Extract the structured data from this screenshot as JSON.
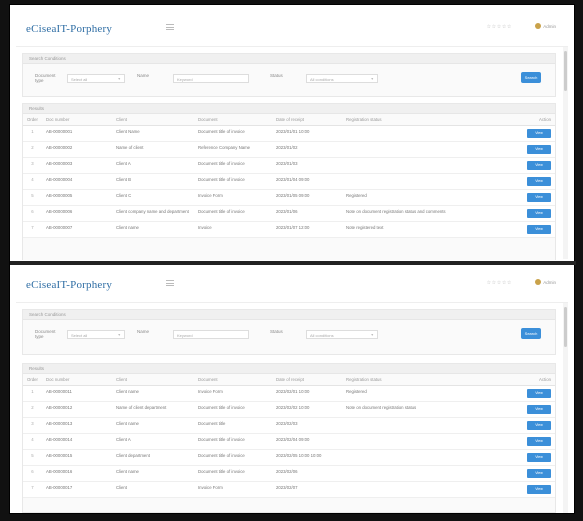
{
  "app": {
    "logo": "eCiseaIT-Porphery",
    "user_name": "Admin",
    "stars": "☆☆☆☆☆"
  },
  "screens": [
    {
      "search": {
        "title": "Search Conditions",
        "label1": "Document type",
        "value1": "Select all",
        "label2": "Name",
        "value2": "Keyword",
        "label3": "Status",
        "value3": "All conditions",
        "button": "Search"
      },
      "list_title": "Results",
      "columns": [
        "Order",
        "Doc number",
        "Client",
        "Document",
        "Date of receipt",
        "Registration status",
        "Action"
      ],
      "rows": [
        {
          "order": "1",
          "doc": "AB-00000001",
          "client": "Client Name",
          "document": "Document title of invoice",
          "date": "2023/01/01 10:00",
          "status": "",
          "action": "View"
        },
        {
          "order": "2",
          "doc": "AB-00000002",
          "client": "Name of client",
          "document": "Reference Company Name",
          "date": "2023/01/02",
          "status": "",
          "action": "View"
        },
        {
          "order": "3",
          "doc": "AB-00000003",
          "client": "Client A",
          "document": "Document title of invoice",
          "date": "2023/01/03",
          "status": "",
          "action": "View"
        },
        {
          "order": "4",
          "doc": "AB-00000004",
          "client": "Client B",
          "document": "Document title of invoice",
          "date": "2023/01/04 09:00",
          "status": "",
          "action": "View"
        },
        {
          "order": "5",
          "doc": "AB-00000005",
          "client": "Client C",
          "document": "Invoice Form",
          "date": "2023/01/05 09:00",
          "status": "Registered",
          "action": "View"
        },
        {
          "order": "6",
          "doc": "AB-00000006",
          "client": "Client company name and department",
          "document": "Document title of invoice",
          "date": "2023/01/06",
          "status": "Note on document registration status and comments",
          "action": "View"
        },
        {
          "order": "7",
          "doc": "AB-00000007",
          "client": "Client name",
          "document": "Invoice",
          "date": "2023/01/07 12:00",
          "status": "Note registered text",
          "action": "View"
        }
      ]
    },
    {
      "search": {
        "title": "Search Conditions",
        "label1": "Document type",
        "value1": "Select all",
        "label2": "Name",
        "value2": "Keyword",
        "label3": "Status",
        "value3": "All conditions",
        "button": "Search"
      },
      "list_title": "Results",
      "columns": [
        "Order",
        "Doc number",
        "Client",
        "Document",
        "Date of receipt",
        "Registration status",
        "Action"
      ],
      "rows": [
        {
          "order": "1",
          "doc": "AB-00000011",
          "client": "Client name",
          "document": "Invoice Form",
          "date": "2023/02/01 10:00",
          "status": "Registered",
          "action": "View"
        },
        {
          "order": "2",
          "doc": "AB-00000012",
          "client": "Name of client department",
          "document": "Document title of invoice",
          "date": "2023/02/02 10:00",
          "status": "Note on document registration status",
          "action": "View"
        },
        {
          "order": "3",
          "doc": "AB-00000013",
          "client": "Client name",
          "document": "Document title",
          "date": "2023/02/03",
          "status": "",
          "action": "View"
        },
        {
          "order": "4",
          "doc": "AB-00000014",
          "client": "Client A",
          "document": "Document title of invoice",
          "date": "2023/02/04 09:00",
          "status": "",
          "action": "View"
        },
        {
          "order": "5",
          "doc": "AB-00000015",
          "client": "Client department",
          "document": "Document title of invoice",
          "date": "2023/02/05 10:00 10:00",
          "status": "",
          "action": "View"
        },
        {
          "order": "6",
          "doc": "AB-00000016",
          "client": "Client name",
          "document": "Document title of invoice",
          "date": "2023/02/06",
          "status": "",
          "action": "View"
        },
        {
          "order": "7",
          "doc": "AB-00000017",
          "client": "Client",
          "document": "Invoice Form",
          "date": "2023/02/07",
          "status": "",
          "action": "View"
        }
      ]
    }
  ]
}
